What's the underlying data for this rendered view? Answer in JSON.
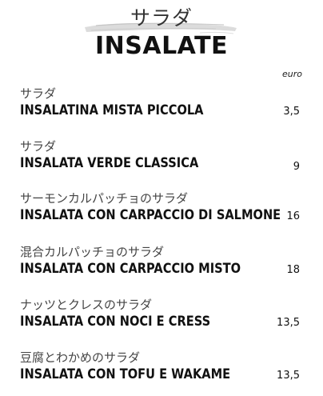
{
  "header": {
    "title_jp": "サラダ",
    "title_it": "INSALATE"
  },
  "currency_label": "euro",
  "items": [
    {
      "name_jp": "サラダ",
      "name_it": "INSALATINA MISTA PICCOLA",
      "price": "3,5"
    },
    {
      "name_jp": "サラダ",
      "name_it": "INSALATA VERDE CLASSICA",
      "price": "9"
    },
    {
      "name_jp": "サーモンカルパッチョのサラダ",
      "name_it": "INSALATA CON CARPACCIO DI SALMONE",
      "price": "16"
    },
    {
      "name_jp": "混合カルパッチョのサラダ",
      "name_it": "INSALATA CON CARPACCIO MISTO",
      "price": "18"
    },
    {
      "name_jp": "ナッツとクレスのサラダ",
      "name_it": "INSALATA CON NOCI E CRESS",
      "price": "13,5"
    },
    {
      "name_jp": "豆腐とわかめのサラダ",
      "name_it": "INSALATA CON TOFU E WAKAME",
      "price": "13,5"
    }
  ]
}
